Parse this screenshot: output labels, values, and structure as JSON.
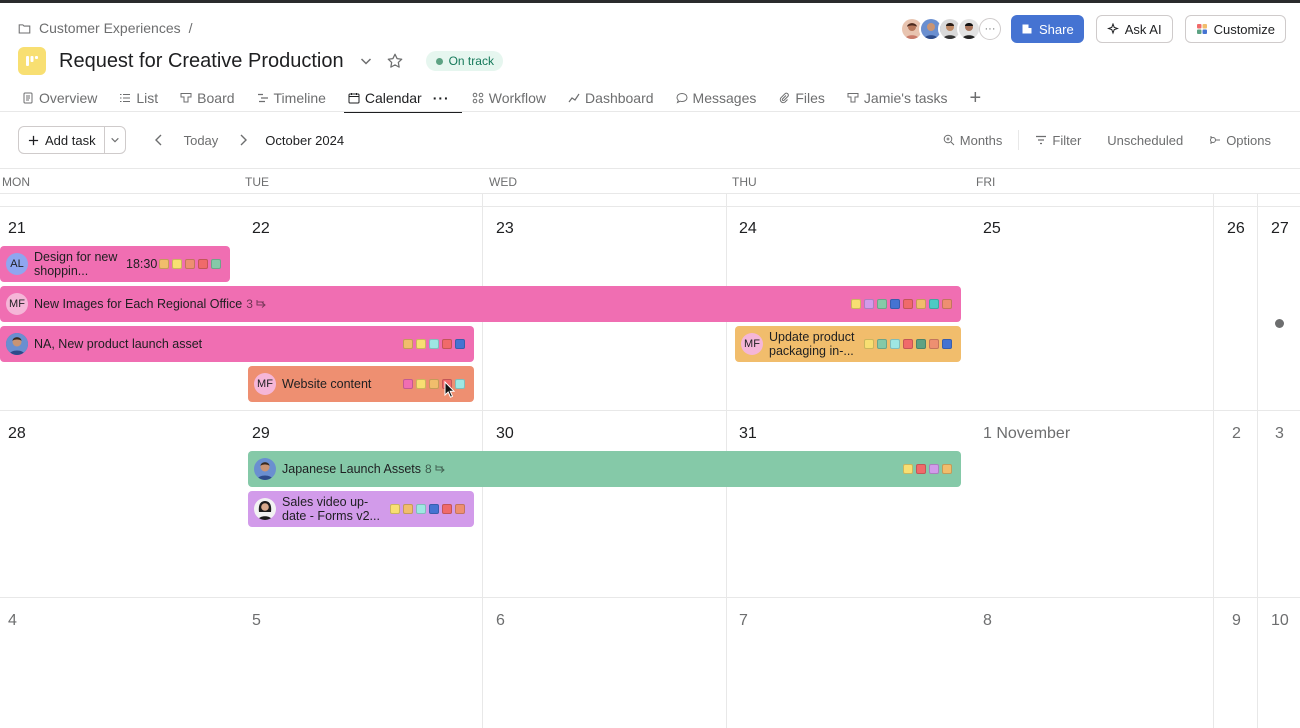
{
  "breadcrumb": {
    "parent": "Customer Experiences",
    "sep": "/"
  },
  "project": {
    "title": "Request for Creative Production",
    "status": "On track"
  },
  "header": {
    "avatars_more": "···",
    "share": "Share",
    "ask_ai": "Ask AI",
    "customize": "Customize"
  },
  "tabs": [
    {
      "label": "Overview",
      "icon": "doc-icon"
    },
    {
      "label": "List",
      "icon": "list-icon"
    },
    {
      "label": "Board",
      "icon": "board-icon"
    },
    {
      "label": "Timeline",
      "icon": "timeline-icon"
    },
    {
      "label": "Calendar",
      "icon": "calendar-icon",
      "active": true
    },
    {
      "label": "Workflow",
      "icon": "workflow-icon"
    },
    {
      "label": "Dashboard",
      "icon": "dashboard-icon"
    },
    {
      "label": "Messages",
      "icon": "message-icon"
    },
    {
      "label": "Files",
      "icon": "paperclip-icon"
    },
    {
      "label": "Jamie's tasks",
      "icon": "board-icon"
    }
  ],
  "toolbar": {
    "add_task": "Add task",
    "today": "Today",
    "month": "October 2024",
    "months": "Months",
    "filter": "Filter",
    "unscheduled": "Unscheduled",
    "options": "Options"
  },
  "weekdays": [
    "MON",
    "TUE",
    "WED",
    "THU",
    "FRI"
  ],
  "weeks": [
    [
      "21",
      "22",
      "23",
      "24",
      "25",
      "26",
      "27"
    ],
    [
      "28",
      "29",
      "30",
      "31",
      "1 November",
      "2",
      "3"
    ],
    [
      "4",
      "5",
      "6",
      "7",
      "8",
      "9",
      "10"
    ]
  ],
  "tasks": {
    "design": {
      "name": "Design for new shoppin...",
      "initials": "AL",
      "time": "18:30"
    },
    "regional": {
      "name": "New Images for Each Regional Office",
      "initials": "MF",
      "subtasks": "3"
    },
    "launch": {
      "name": "NA, New product launch asset"
    },
    "packaging": {
      "name": "Update product packaging in-...",
      "initials": "MF"
    },
    "website": {
      "name": "Website content",
      "initials": "MF"
    },
    "japanese": {
      "name": "Japanese Launch Assets",
      "subtasks": "8"
    },
    "sales": {
      "name": "Sales video up-date - Forms v2..."
    }
  },
  "colors": {
    "pink": "#f06eb2",
    "orange": "#ee8f71",
    "amber": "#f1bd6c",
    "green": "#85c9a8",
    "purple": "#d29bea",
    "accent": "#4573d2"
  }
}
